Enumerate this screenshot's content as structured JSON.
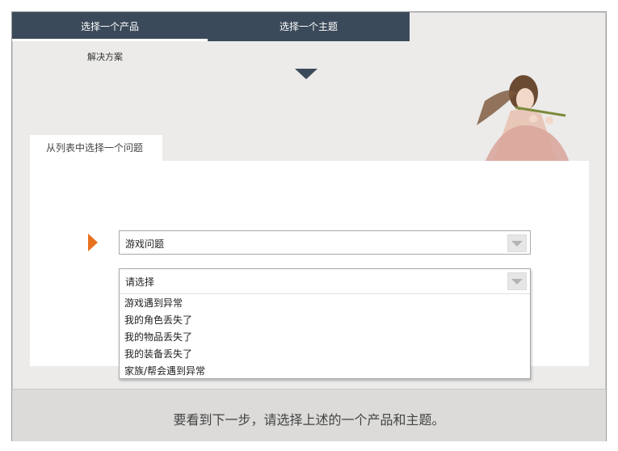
{
  "tabs": [
    {
      "label": "选择一个产品"
    },
    {
      "label": "选择一个主题"
    }
  ],
  "product_sub": "解决方案",
  "question_tab": "从列表中选择一个问题",
  "select1": {
    "value": "游戏问题"
  },
  "select2": {
    "value": "请选择",
    "options": [
      "游戏遇到异常",
      "我的角色丢失了",
      "我的物品丢失了",
      "我的装备丢失了",
      "家族/帮会遇到异常"
    ]
  },
  "footer_message": "要看到下一步，请选择上述的一个产品和主题。",
  "colors": {
    "tab_bg": "#3b4a5a",
    "pointer": "#e8711f"
  }
}
